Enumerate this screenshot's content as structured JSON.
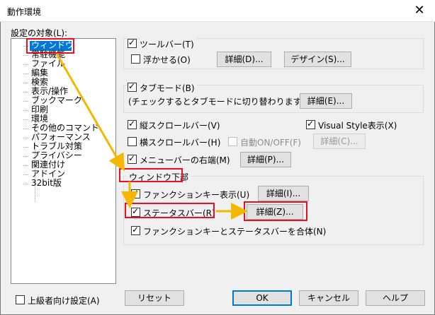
{
  "window": {
    "title": "動作環境",
    "close_glyph": "✕"
  },
  "tree": {
    "label": "設定の対象(L):",
    "items": [
      "ウィンドウ",
      "常駐機能",
      "ファイル",
      "編集",
      "検索",
      "表示/操作",
      "ブックマーク",
      "印刷",
      "環境",
      "その他のコマンド",
      "パフォーマンス",
      "トラブル対策",
      "プライバシー",
      "関連付け",
      "アドイン",
      "32bit版"
    ],
    "selected": "ウィンドウ"
  },
  "toolbar_group": {
    "toolbar_label": "ツールバー(T)",
    "float_label": "浮かせる(O)",
    "detail_button": "詳細(D)...",
    "design_button": "デザイン(S)..."
  },
  "tab_group": {
    "tabmode_label": "タブモード(B)",
    "note": "(チェックするとタブモードに切り替わります)",
    "detail_button": "詳細(E)..."
  },
  "scroll_group": {
    "vscroll_label": "縦スクロールバー(V)",
    "visual_style_label": "Visual Style表示(X)",
    "hscroll_label": "横スクロールバー(H)",
    "auto_label": "自動ON/OFF(F)",
    "auto_detail_button": "詳細(C)...",
    "menubar_label": "メニューバーの右端(M)",
    "menubar_detail_button": "詳細(P)..."
  },
  "bottom_group": {
    "title": "ウィンドウ下部",
    "function_key_label": "ファンクションキー表示(U)",
    "function_key_detail_button": "詳細(I)...",
    "status_bar_label": "ステータスバー(R)",
    "status_bar_detail_button": "詳細(Z)...",
    "combine_label": "ファンクションキーとステータスバーを合体(N)"
  },
  "footer": {
    "advanced_label": "上級者向け設定(A)",
    "reset_button": "リセット",
    "ok_button": "OK",
    "cancel_button": "キャンセル",
    "help_button": "ヘルプ"
  },
  "colors": {
    "annotation_red": "#e81123",
    "annotation_arrow": "#f5b800",
    "selection": "#0078d7"
  }
}
